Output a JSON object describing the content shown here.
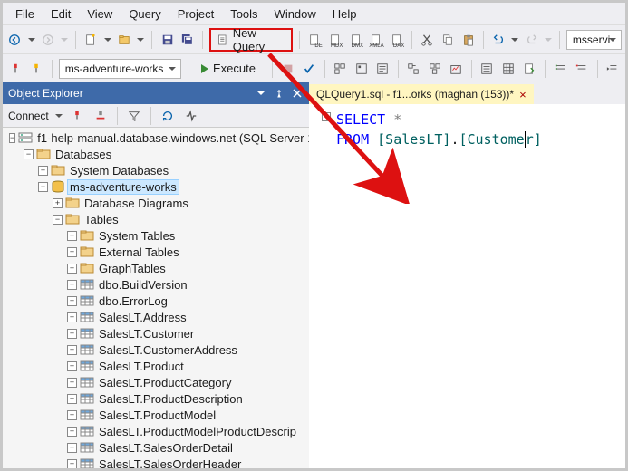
{
  "menu": [
    "File",
    "Edit",
    "View",
    "Query",
    "Project",
    "Tools",
    "Window",
    "Help"
  ],
  "toolbar": {
    "new_query": "New Query",
    "server_box": "msservi"
  },
  "toolbar2": {
    "db_combo": "ms-adventure-works",
    "execute": "Execute"
  },
  "panel": {
    "title": "Object Explorer",
    "connect_label": "Connect"
  },
  "tree": [
    {
      "d": 0,
      "exp": "-",
      "icon": "server",
      "label": "f1-help-manual.database.windows.net (SQL Server 1",
      "sel": false
    },
    {
      "d": 1,
      "exp": "-",
      "icon": "folder",
      "label": "Databases",
      "sel": false
    },
    {
      "d": 2,
      "exp": "+",
      "icon": "folder",
      "label": "System Databases",
      "sel": false
    },
    {
      "d": 2,
      "exp": "-",
      "icon": "db",
      "label": "ms-adventure-works",
      "sel": true
    },
    {
      "d": 3,
      "exp": "+",
      "icon": "folder",
      "label": "Database Diagrams",
      "sel": false
    },
    {
      "d": 3,
      "exp": "-",
      "icon": "folder",
      "label": "Tables",
      "sel": false
    },
    {
      "d": 4,
      "exp": "+",
      "icon": "folder",
      "label": "System Tables",
      "sel": false
    },
    {
      "d": 4,
      "exp": "+",
      "icon": "folder",
      "label": "External Tables",
      "sel": false
    },
    {
      "d": 4,
      "exp": "+",
      "icon": "folder",
      "label": "GraphTables",
      "sel": false
    },
    {
      "d": 4,
      "exp": "+",
      "icon": "table",
      "label": "dbo.BuildVersion",
      "sel": false
    },
    {
      "d": 4,
      "exp": "+",
      "icon": "table",
      "label": "dbo.ErrorLog",
      "sel": false
    },
    {
      "d": 4,
      "exp": "+",
      "icon": "table",
      "label": "SalesLT.Address",
      "sel": false
    },
    {
      "d": 4,
      "exp": "+",
      "icon": "table",
      "label": "SalesLT.Customer",
      "sel": false
    },
    {
      "d": 4,
      "exp": "+",
      "icon": "table",
      "label": "SalesLT.CustomerAddress",
      "sel": false
    },
    {
      "d": 4,
      "exp": "+",
      "icon": "table",
      "label": "SalesLT.Product",
      "sel": false
    },
    {
      "d": 4,
      "exp": "+",
      "icon": "table",
      "label": "SalesLT.ProductCategory",
      "sel": false
    },
    {
      "d": 4,
      "exp": "+",
      "icon": "table",
      "label": "SalesLT.ProductDescription",
      "sel": false
    },
    {
      "d": 4,
      "exp": "+",
      "icon": "table",
      "label": "SalesLT.ProductModel",
      "sel": false
    },
    {
      "d": 4,
      "exp": "+",
      "icon": "table",
      "label": "SalesLT.ProductModelProductDescrip",
      "sel": false
    },
    {
      "d": 4,
      "exp": "+",
      "icon": "table",
      "label": "SalesLT.SalesOrderDetail",
      "sel": false
    },
    {
      "d": 4,
      "exp": "+",
      "icon": "table",
      "label": "SalesLT.SalesOrderHeader",
      "sel": false
    }
  ],
  "editor": {
    "tab_label": "QLQuery1.sql - f1...orks (maghan (153))*",
    "line1_kw": "SELECT",
    "line1_rest": " *",
    "line2_kw": "FROM",
    "line2_id1": "[SalesLT]",
    "line2_dot": ".",
    "line2_id2a": "[Custome",
    "line2_id2b": "r]"
  }
}
